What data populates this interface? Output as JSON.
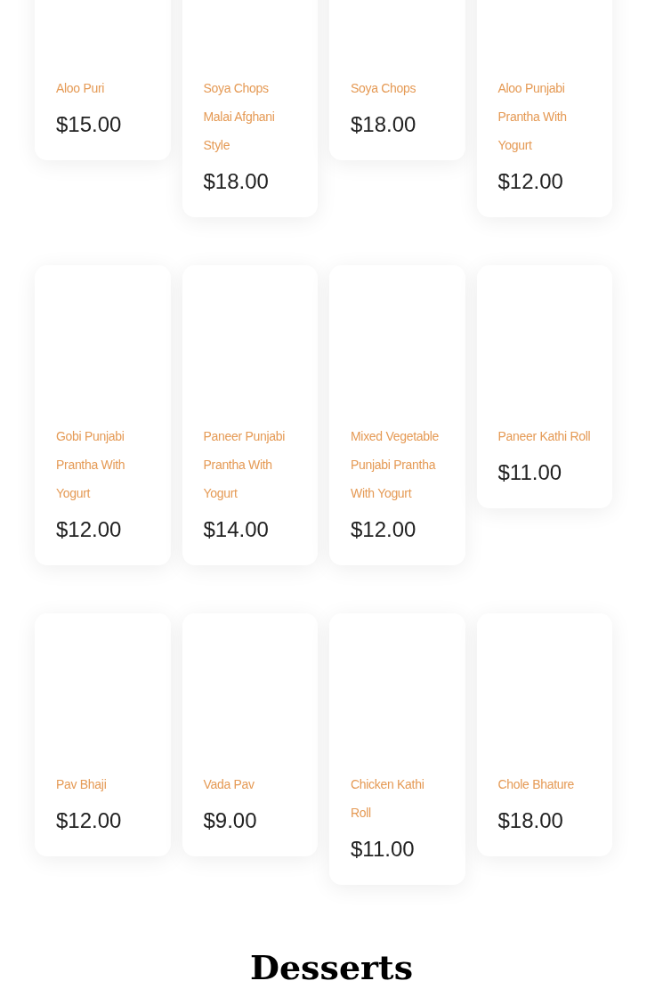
{
  "menu_items": [
    {
      "name": "Aloo Puri",
      "price": "$15.00"
    },
    {
      "name": "Soya Chops Malai Afghani Style",
      "price": "$18.00"
    },
    {
      "name": "Soya Chops",
      "price": "$18.00"
    },
    {
      "name": "Aloo Punjabi Prantha With Yogurt",
      "price": "$12.00"
    },
    {
      "name": "Gobi Punjabi Prantha With Yogurt",
      "price": "$12.00"
    },
    {
      "name": "Paneer Punjabi Prantha With Yogurt",
      "price": "$14.00"
    },
    {
      "name": "Mixed Vegetable Punjabi Prantha With Yogurt",
      "price": "$12.00"
    },
    {
      "name": "Paneer Kathi Roll",
      "price": "$11.00"
    },
    {
      "name": "Pav Bhaji",
      "price": "$12.00"
    },
    {
      "name": "Vada Pav",
      "price": "$9.00"
    },
    {
      "name": "Chicken Kathi Roll",
      "price": "$11.00"
    },
    {
      "name": "Chole Bhature",
      "price": "$18.00"
    }
  ],
  "next_section": {
    "title": "Desserts"
  }
}
